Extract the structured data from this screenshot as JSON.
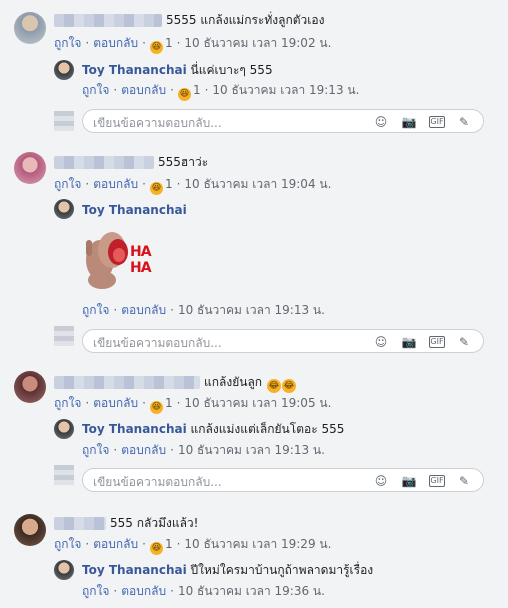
{
  "ui": {
    "like": "ถูกใจ",
    "reply": "ตอบกลับ",
    "input_placeholder": "เขียนข้อความตอบกลับ...",
    "separator": "·"
  },
  "threads": [
    {
      "comment": {
        "text": "5555 แกล้งแม่กระทั่งลูกตัวเอง",
        "reaction_count": "1",
        "time": "10 ธันวาคม เวลา 19:02 น."
      },
      "reply": {
        "name": "Toy Thananchai",
        "text": "นี่แค่เบาะๆ 555",
        "reaction_count": "1",
        "time": "10 ธันวาคม เวลา 19:13 น."
      }
    },
    {
      "comment": {
        "text": "555ฮาว่ะ",
        "reaction_count": "1",
        "time": "10 ธันวาคม เวลา 19:04 น."
      },
      "reply": {
        "name": "Toy Thananchai",
        "sticker_text": "HA HA",
        "time": "10 ธันวาคม เวลา 19:13 น."
      }
    },
    {
      "comment": {
        "text": "แกล้งยันลูก",
        "reaction_count": "1",
        "time": "10 ธันวาคม เวลา 19:05 น."
      },
      "reply": {
        "name": "Toy Thananchai",
        "text": "แกล้งแม่งแต่เล็กยันโตอะ 555",
        "time": "10 ธันวาคม เวลา 19:13 น."
      }
    },
    {
      "comment": {
        "text": "555 กลัวมึงแล้ว!",
        "reaction_count": "1",
        "time": "10 ธันวาคม เวลา 19:29 น."
      },
      "reply": {
        "name": "Toy Thananchai",
        "text": "ปีใหม่ใครมาบ้านกูถ้าพลาดมารู้เรื่อง",
        "time": "10 ธันวาคม เวลา 19:36 น."
      }
    }
  ]
}
